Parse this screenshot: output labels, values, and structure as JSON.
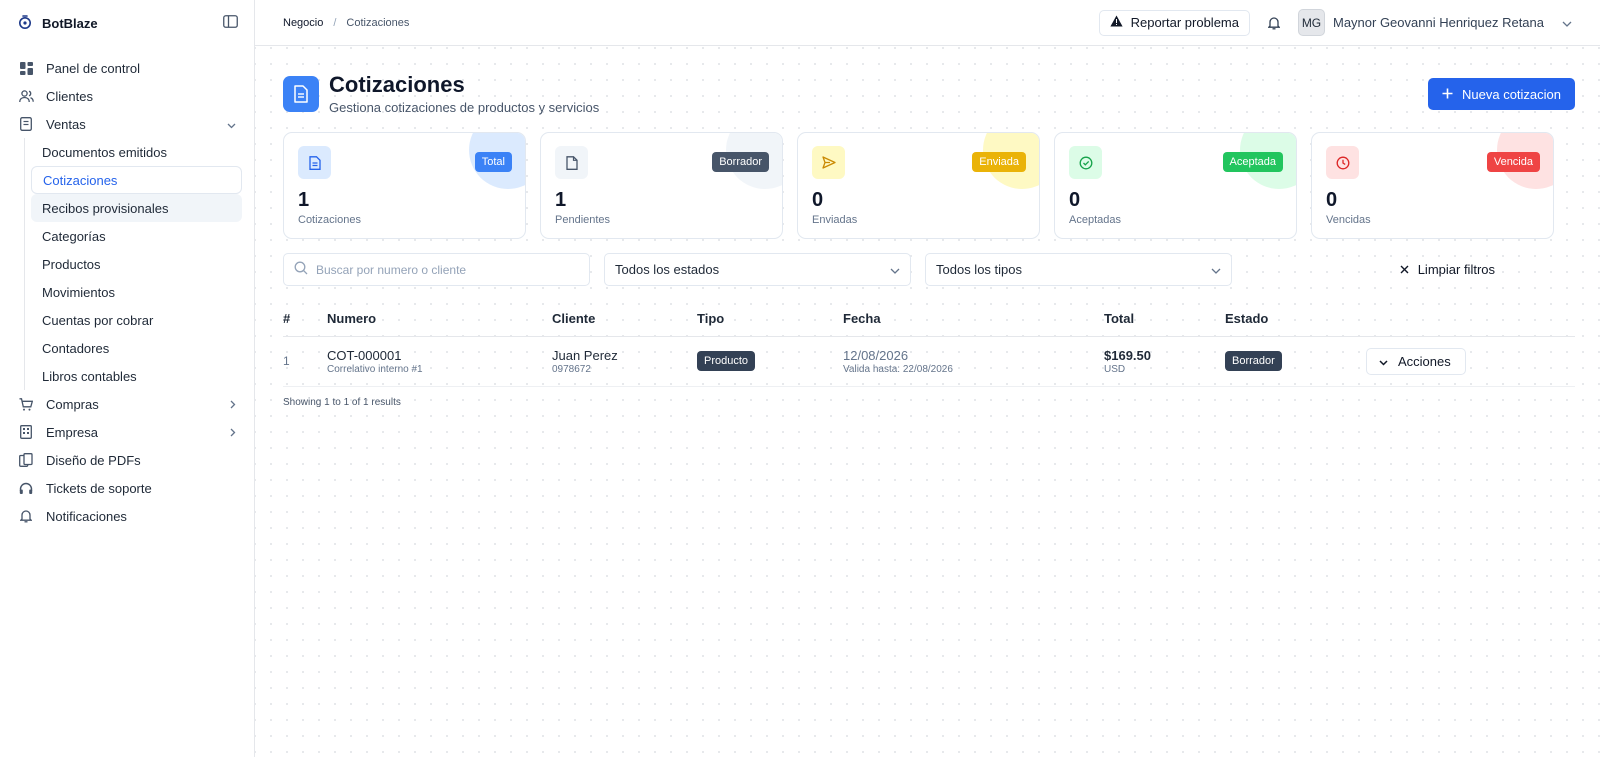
{
  "brand": {
    "name": "BotBlaze"
  },
  "sidebar": {
    "items": [
      {
        "label": "Panel de control",
        "icon": "dashboard-icon"
      },
      {
        "label": "Clientes",
        "icon": "users-icon"
      },
      {
        "label": "Ventas",
        "icon": "receipt-icon",
        "expanded": true
      },
      {
        "label": "Compras",
        "icon": "cart-icon"
      },
      {
        "label": "Empresa",
        "icon": "building-icon"
      },
      {
        "label": "Diseño de PDFs",
        "icon": "pdf-design-icon"
      },
      {
        "label": "Tickets de soporte",
        "icon": "headset-icon"
      },
      {
        "label": "Notificaciones",
        "icon": "bell-icon"
      }
    ],
    "ventas_sub": [
      "Documentos emitidos",
      "Cotizaciones",
      "Recibos provisionales",
      "Categorías",
      "Productos",
      "Movimientos",
      "Cuentas por cobrar",
      "Contadores",
      "Libros contables"
    ]
  },
  "header": {
    "breadcrumb": [
      "Negocio",
      "Cotizaciones"
    ],
    "breadcrumb_sep": "/",
    "report_label": "Reportar problema",
    "user_initials": "MG",
    "user_name": "Maynor Geovanni Henriquez Retana"
  },
  "page": {
    "title": "Cotizaciones",
    "subtitle": "Gestiona cotizaciones de productos y servicios",
    "new_button": "Nueva cotizacion"
  },
  "cards": [
    {
      "badge": "Total",
      "value": "1",
      "label": "Cotizaciones",
      "color": "#3b82f6",
      "soft": "#dbeafe",
      "icon": "document-icon"
    },
    {
      "badge": "Borrador",
      "value": "1",
      "label": "Pendientes",
      "color": "#475569",
      "soft": "#f1f5f9",
      "icon": "file-icon"
    },
    {
      "badge": "Enviada",
      "value": "0",
      "label": "Enviadas",
      "color": "#eab308",
      "soft": "#fef9c3",
      "icon": "send-icon"
    },
    {
      "badge": "Aceptada",
      "value": "0",
      "label": "Aceptadas",
      "color": "#22c55e",
      "soft": "#dcfce7",
      "icon": "check-circle-icon"
    },
    {
      "badge": "Vencida",
      "value": "0",
      "label": "Vencidas",
      "color": "#ef4444",
      "soft": "#fee2e2",
      "icon": "clock-icon"
    }
  ],
  "filters": {
    "search_placeholder": "Buscar por numero o cliente",
    "status_select": "Todos los estados",
    "type_select": "Todos los tipos",
    "clear_label": "Limpiar filtros"
  },
  "table": {
    "columns": [
      "#",
      "Numero",
      "Cliente",
      "Tipo",
      "Fecha",
      "Total",
      "Estado"
    ],
    "rows": [
      {
        "index": "1",
        "number": "COT-000001",
        "number_sub": "Correlativo interno #1",
        "client": "Juan Perez",
        "client_sub": "0978672",
        "type": "Producto",
        "date": "12/08/2026",
        "date_sub": "Valida hasta: 22/08/2026",
        "total": "$169.50",
        "currency": "USD",
        "status": "Borrador",
        "actions_label": "Acciones"
      }
    ],
    "footer": "Showing 1 to 1 of 1 results"
  },
  "colors": {
    "primary": "#2563eb",
    "accent": "#3b82f6",
    "draft": "#334155"
  }
}
